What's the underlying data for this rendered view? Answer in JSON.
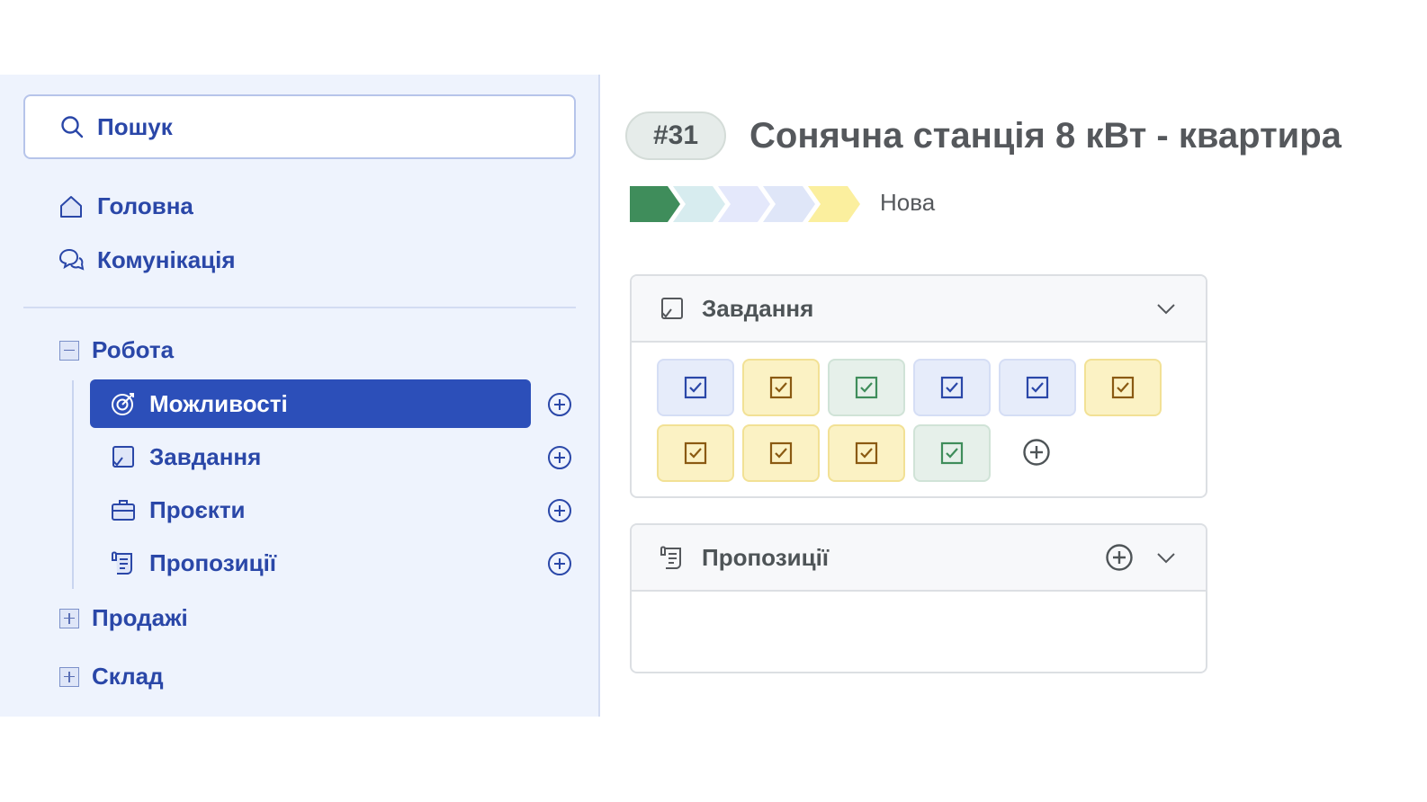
{
  "sidebar": {
    "search": {
      "label": "Пошук"
    },
    "main_nav": [
      {
        "label": "Головна",
        "icon": "home-icon"
      },
      {
        "label": "Комунікація",
        "icon": "chat-icon"
      }
    ],
    "groups": {
      "work": {
        "label": "Робота",
        "state": "expanded"
      },
      "sales": {
        "label": "Продажі",
        "state": "collapsed"
      },
      "warehouse": {
        "label": "Склад",
        "state": "collapsed"
      }
    },
    "work_items": [
      {
        "label": "Можливості",
        "icon": "target-icon",
        "active": true
      },
      {
        "label": "Завдання",
        "icon": "task-icon",
        "active": false
      },
      {
        "label": "Проєкти",
        "icon": "briefcase-icon",
        "active": false
      },
      {
        "label": "Пропозиції",
        "icon": "scroll-icon",
        "active": false
      }
    ]
  },
  "main": {
    "badge": "#31",
    "title": "Сонячна станція 8 кВт - квартира",
    "pipeline": {
      "stage_label": "Нова",
      "stage_colors": [
        "#3f8d5b",
        "#d7ecef",
        "#e4e8fb",
        "#dfe6f8",
        "#fbef9e"
      ]
    },
    "tasks_panel": {
      "title": "Завдання",
      "tiles": [
        {
          "color": "blue"
        },
        {
          "color": "yellow"
        },
        {
          "color": "green"
        },
        {
          "color": "blue"
        },
        {
          "color": "blue"
        },
        {
          "color": "yellow"
        },
        {
          "color": "yellow"
        },
        {
          "color": "yellow"
        },
        {
          "color": "yellow"
        },
        {
          "color": "green"
        }
      ]
    },
    "proposals_panel": {
      "title": "Пропозиції"
    }
  },
  "colors": {
    "accent": "#2c4fb9",
    "sidebar_bg": "#eef3fd",
    "tile_blue_icon": "#2a47a8",
    "tile_yellow_icon": "#8a5a12",
    "tile_green_icon": "#3f8d5b"
  }
}
